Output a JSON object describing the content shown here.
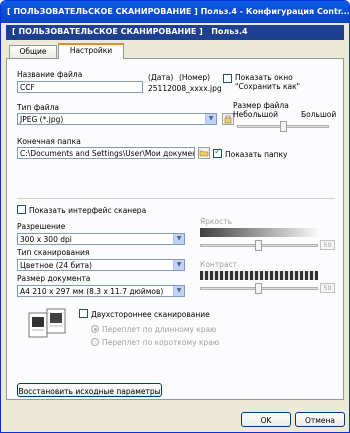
{
  "window": {
    "title": "[ ПОЛЬЗОВАТЕЛЬСКОЕ СКАНИРОВАНИЕ ] Польз.4 - Конфигурация Contr..."
  },
  "header": {
    "title": "[ ПОЛЬЗОВАТЕЛЬСКОЕ СКАНИРОВАНИЕ ]",
    "profile": "Польз.4"
  },
  "tabs": [
    {
      "label": "Общие",
      "active": false
    },
    {
      "label": "Настройки",
      "active": true
    }
  ],
  "file": {
    "name_label": "Название файла",
    "name_value": "CCF",
    "date_label": "(Дата)",
    "number_label": "(Номер)",
    "preview": "25112008_xxxx.jpg",
    "show_save_as_label": "Показать окно \"Сохранить как\"",
    "type_label": "Тип файла",
    "type_value": "JPEG (*.jpg)",
    "size_label": "Размер файла",
    "size_min": "Небольшой",
    "size_max": "Большой",
    "dest_label": "Конечная папка",
    "dest_value": "C:\\Documents and Settings\\User\\Мои документы\\М",
    "show_folder_label": "Показать папку",
    "show_folder_checked": true,
    "show_save_as_checked": false,
    "size_level": 0.5
  },
  "scan": {
    "show_interface_label": "Показать интерфейс сканера",
    "resolution_label": "Разрешение",
    "resolution_value": "300 x 300 dpi",
    "scan_type_label": "Тип сканирования",
    "scan_type_value": "Цветное (24 бита)",
    "doc_size_label": "Размер документа",
    "doc_size_value": "A4 210 x 297 мм (8.3 x 11.7 дюймов)",
    "brightness_label": "Яркость",
    "brightness_value": "50",
    "contrast_label": "Контраст",
    "contrast_value": "50",
    "duplex_label": "Двухстороннее сканирование",
    "long_edge_label": "Переплет по длинному краю",
    "short_edge_label": "Переплет по короткому краю"
  },
  "buttons": {
    "restore": "Восстановить исходные параметры",
    "ok": "OK",
    "cancel": "Отмена"
  }
}
